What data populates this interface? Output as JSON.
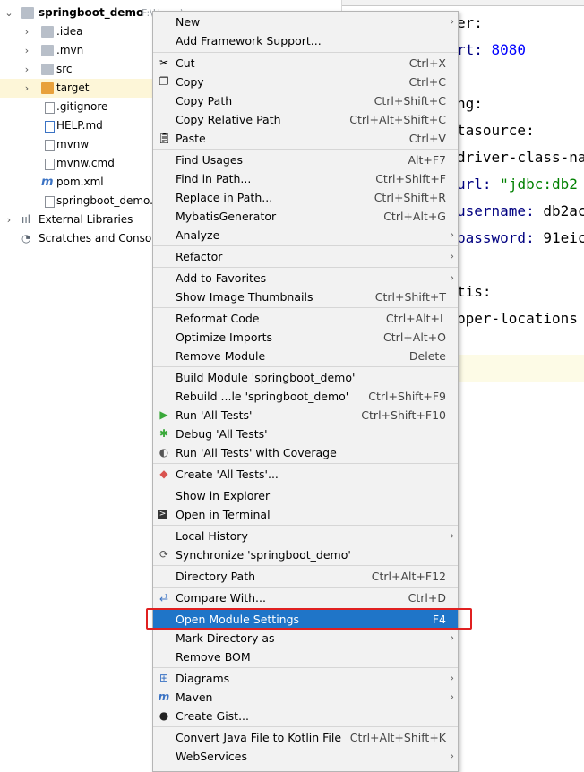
{
  "tree": {
    "root": {
      "label": "springboot_demo",
      "path_hint": "F:\\Users\\pro..."
    },
    "items": [
      {
        "label": ".idea"
      },
      {
        "label": ".mvn"
      },
      {
        "label": "src"
      },
      {
        "label": "target"
      },
      {
        "label": ".gitignore"
      },
      {
        "label": "HELP.md"
      },
      {
        "label": "mvnw"
      },
      {
        "label": "mvnw.cmd"
      },
      {
        "label": "pom.xml"
      },
      {
        "label": "springboot_demo.iml"
      },
      {
        "label": "External Libraries"
      },
      {
        "label": "Scratches and Consoles"
      }
    ]
  },
  "editor": {
    "lines": [
      {
        "text": "er:"
      },
      {
        "key": "rt: ",
        "val": "8080"
      },
      {
        "text": "ng:"
      },
      {
        "text": "tasource:"
      },
      {
        "text": "driver-class-na"
      },
      {
        "key": "url: ",
        "val": "\"jdbc:db2"
      },
      {
        "key": "username: ",
        "val": "db2ac"
      },
      {
        "key": "password: ",
        "val": "91eic"
      },
      {
        "text": "tis:"
      },
      {
        "text": "pper-locations"
      }
    ]
  },
  "menu": {
    "items": [
      {
        "label": "New",
        "shortcut": "",
        "submenu": true
      },
      {
        "label": "Add Framework Support...",
        "shortcut": ""
      },
      {
        "label": "Cut",
        "shortcut": "Ctrl+X",
        "icon": "cut-icon"
      },
      {
        "label": "Copy",
        "shortcut": "Ctrl+C",
        "icon": "copy-icon"
      },
      {
        "label": "Copy Path",
        "shortcut": "Ctrl+Shift+C"
      },
      {
        "label": "Copy Relative Path",
        "shortcut": "Ctrl+Alt+Shift+C"
      },
      {
        "label": "Paste",
        "shortcut": "Ctrl+V",
        "icon": "paste-icon"
      },
      {
        "label": "Find Usages",
        "shortcut": "Alt+F7"
      },
      {
        "label": "Find in Path...",
        "shortcut": "Ctrl+Shift+F"
      },
      {
        "label": "Replace in Path...",
        "shortcut": "Ctrl+Shift+R"
      },
      {
        "label": "MybatisGenerator",
        "shortcut": "Ctrl+Alt+G"
      },
      {
        "label": "Analyze",
        "shortcut": "",
        "submenu": true
      },
      {
        "label": "Refactor",
        "shortcut": "",
        "submenu": true
      },
      {
        "label": "Add to Favorites",
        "shortcut": "",
        "submenu": true
      },
      {
        "label": "Show Image Thumbnails",
        "shortcut": "Ctrl+Shift+T"
      },
      {
        "label": "Reformat Code",
        "shortcut": "Ctrl+Alt+L"
      },
      {
        "label": "Optimize Imports",
        "shortcut": "Ctrl+Alt+O"
      },
      {
        "label": "Remove Module",
        "shortcut": "Delete"
      },
      {
        "label": "Build Module 'springboot_demo'",
        "shortcut": ""
      },
      {
        "label": "Rebuild ...le 'springboot_demo'",
        "shortcut": "Ctrl+Shift+F9"
      },
      {
        "label": "Run 'All Tests'",
        "shortcut": "Ctrl+Shift+F10",
        "icon": "run-icon"
      },
      {
        "label": "Debug 'All Tests'",
        "shortcut": "",
        "icon": "debug-icon"
      },
      {
        "label": "Run 'All Tests' with Coverage",
        "shortcut": "",
        "icon": "coverage-icon"
      },
      {
        "label": "Create 'All Tests'...",
        "shortcut": "",
        "icon": "create-test-icon"
      },
      {
        "label": "Show in Explorer",
        "shortcut": ""
      },
      {
        "label": "Open in Terminal",
        "shortcut": "",
        "icon": "terminal-icon"
      },
      {
        "label": "Local History",
        "shortcut": "",
        "submenu": true
      },
      {
        "label": "Synchronize 'springboot_demo'",
        "shortcut": "",
        "icon": "sync-icon"
      },
      {
        "label": "Directory Path",
        "shortcut": "Ctrl+Alt+F12"
      },
      {
        "label": "Compare With...",
        "shortcut": "Ctrl+D",
        "icon": "compare-icon"
      },
      {
        "label": "Open Module Settings",
        "shortcut": "F4"
      },
      {
        "label": "Mark Directory as",
        "shortcut": "",
        "submenu": true
      },
      {
        "label": "Remove BOM",
        "shortcut": ""
      },
      {
        "label": "Diagrams",
        "shortcut": "",
        "submenu": true,
        "icon": "diagram-icon"
      },
      {
        "label": "Maven",
        "shortcut": "",
        "submenu": true,
        "icon": "maven-icon"
      },
      {
        "label": "Create Gist...",
        "shortcut": "",
        "icon": "github-icon"
      },
      {
        "label": "Convert Java File to Kotlin File",
        "shortcut": "Ctrl+Alt+Shift+K"
      },
      {
        "label": "WebServices",
        "shortcut": "",
        "submenu": true
      }
    ]
  },
  "colors": {
    "selection": "#1f75c8",
    "callout": "#e02020",
    "menu_bg": "#f2f2f2"
  }
}
